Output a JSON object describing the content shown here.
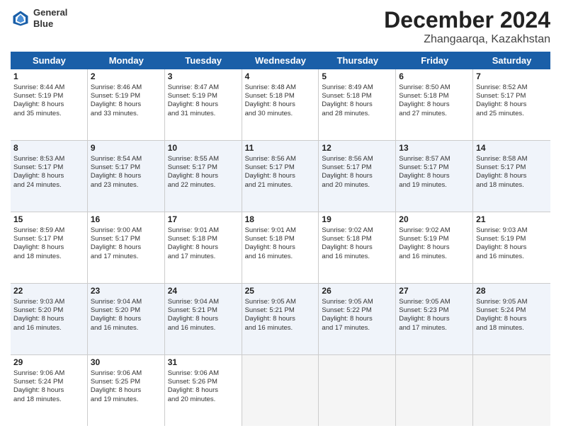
{
  "header": {
    "logo_line1": "General",
    "logo_line2": "Blue",
    "title": "December 2024",
    "subtitle": "Zhangaarqa, Kazakhstan"
  },
  "days": [
    "Sunday",
    "Monday",
    "Tuesday",
    "Wednesday",
    "Thursday",
    "Friday",
    "Saturday"
  ],
  "rows": [
    [
      {
        "num": "1",
        "lines": [
          "Sunrise: 8:44 AM",
          "Sunset: 5:19 PM",
          "Daylight: 8 hours",
          "and 35 minutes."
        ]
      },
      {
        "num": "2",
        "lines": [
          "Sunrise: 8:46 AM",
          "Sunset: 5:19 PM",
          "Daylight: 8 hours",
          "and 33 minutes."
        ]
      },
      {
        "num": "3",
        "lines": [
          "Sunrise: 8:47 AM",
          "Sunset: 5:19 PM",
          "Daylight: 8 hours",
          "and 31 minutes."
        ]
      },
      {
        "num": "4",
        "lines": [
          "Sunrise: 8:48 AM",
          "Sunset: 5:18 PM",
          "Daylight: 8 hours",
          "and 30 minutes."
        ]
      },
      {
        "num": "5",
        "lines": [
          "Sunrise: 8:49 AM",
          "Sunset: 5:18 PM",
          "Daylight: 8 hours",
          "and 28 minutes."
        ]
      },
      {
        "num": "6",
        "lines": [
          "Sunrise: 8:50 AM",
          "Sunset: 5:18 PM",
          "Daylight: 8 hours",
          "and 27 minutes."
        ]
      },
      {
        "num": "7",
        "lines": [
          "Sunrise: 8:52 AM",
          "Sunset: 5:17 PM",
          "Daylight: 8 hours",
          "and 25 minutes."
        ]
      }
    ],
    [
      {
        "num": "8",
        "lines": [
          "Sunrise: 8:53 AM",
          "Sunset: 5:17 PM",
          "Daylight: 8 hours",
          "and 24 minutes."
        ]
      },
      {
        "num": "9",
        "lines": [
          "Sunrise: 8:54 AM",
          "Sunset: 5:17 PM",
          "Daylight: 8 hours",
          "and 23 minutes."
        ]
      },
      {
        "num": "10",
        "lines": [
          "Sunrise: 8:55 AM",
          "Sunset: 5:17 PM",
          "Daylight: 8 hours",
          "and 22 minutes."
        ]
      },
      {
        "num": "11",
        "lines": [
          "Sunrise: 8:56 AM",
          "Sunset: 5:17 PM",
          "Daylight: 8 hours",
          "and 21 minutes."
        ]
      },
      {
        "num": "12",
        "lines": [
          "Sunrise: 8:56 AM",
          "Sunset: 5:17 PM",
          "Daylight: 8 hours",
          "and 20 minutes."
        ]
      },
      {
        "num": "13",
        "lines": [
          "Sunrise: 8:57 AM",
          "Sunset: 5:17 PM",
          "Daylight: 8 hours",
          "and 19 minutes."
        ]
      },
      {
        "num": "14",
        "lines": [
          "Sunrise: 8:58 AM",
          "Sunset: 5:17 PM",
          "Daylight: 8 hours",
          "and 18 minutes."
        ]
      }
    ],
    [
      {
        "num": "15",
        "lines": [
          "Sunrise: 8:59 AM",
          "Sunset: 5:17 PM",
          "Daylight: 8 hours",
          "and 18 minutes."
        ]
      },
      {
        "num": "16",
        "lines": [
          "Sunrise: 9:00 AM",
          "Sunset: 5:17 PM",
          "Daylight: 8 hours",
          "and 17 minutes."
        ]
      },
      {
        "num": "17",
        "lines": [
          "Sunrise: 9:01 AM",
          "Sunset: 5:18 PM",
          "Daylight: 8 hours",
          "and 17 minutes."
        ]
      },
      {
        "num": "18",
        "lines": [
          "Sunrise: 9:01 AM",
          "Sunset: 5:18 PM",
          "Daylight: 8 hours",
          "and 16 minutes."
        ]
      },
      {
        "num": "19",
        "lines": [
          "Sunrise: 9:02 AM",
          "Sunset: 5:18 PM",
          "Daylight: 8 hours",
          "and 16 minutes."
        ]
      },
      {
        "num": "20",
        "lines": [
          "Sunrise: 9:02 AM",
          "Sunset: 5:19 PM",
          "Daylight: 8 hours",
          "and 16 minutes."
        ]
      },
      {
        "num": "21",
        "lines": [
          "Sunrise: 9:03 AM",
          "Sunset: 5:19 PM",
          "Daylight: 8 hours",
          "and 16 minutes."
        ]
      }
    ],
    [
      {
        "num": "22",
        "lines": [
          "Sunrise: 9:03 AM",
          "Sunset: 5:20 PM",
          "Daylight: 8 hours",
          "and 16 minutes."
        ]
      },
      {
        "num": "23",
        "lines": [
          "Sunrise: 9:04 AM",
          "Sunset: 5:20 PM",
          "Daylight: 8 hours",
          "and 16 minutes."
        ]
      },
      {
        "num": "24",
        "lines": [
          "Sunrise: 9:04 AM",
          "Sunset: 5:21 PM",
          "Daylight: 8 hours",
          "and 16 minutes."
        ]
      },
      {
        "num": "25",
        "lines": [
          "Sunrise: 9:05 AM",
          "Sunset: 5:21 PM",
          "Daylight: 8 hours",
          "and 16 minutes."
        ]
      },
      {
        "num": "26",
        "lines": [
          "Sunrise: 9:05 AM",
          "Sunset: 5:22 PM",
          "Daylight: 8 hours",
          "and 17 minutes."
        ]
      },
      {
        "num": "27",
        "lines": [
          "Sunrise: 9:05 AM",
          "Sunset: 5:23 PM",
          "Daylight: 8 hours",
          "and 17 minutes."
        ]
      },
      {
        "num": "28",
        "lines": [
          "Sunrise: 9:05 AM",
          "Sunset: 5:24 PM",
          "Daylight: 8 hours",
          "and 18 minutes."
        ]
      }
    ],
    [
      {
        "num": "29",
        "lines": [
          "Sunrise: 9:06 AM",
          "Sunset: 5:24 PM",
          "Daylight: 8 hours",
          "and 18 minutes."
        ]
      },
      {
        "num": "30",
        "lines": [
          "Sunrise: 9:06 AM",
          "Sunset: 5:25 PM",
          "Daylight: 8 hours",
          "and 19 minutes."
        ]
      },
      {
        "num": "31",
        "lines": [
          "Sunrise: 9:06 AM",
          "Sunset: 5:26 PM",
          "Daylight: 8 hours",
          "and 20 minutes."
        ]
      },
      null,
      null,
      null,
      null
    ]
  ]
}
